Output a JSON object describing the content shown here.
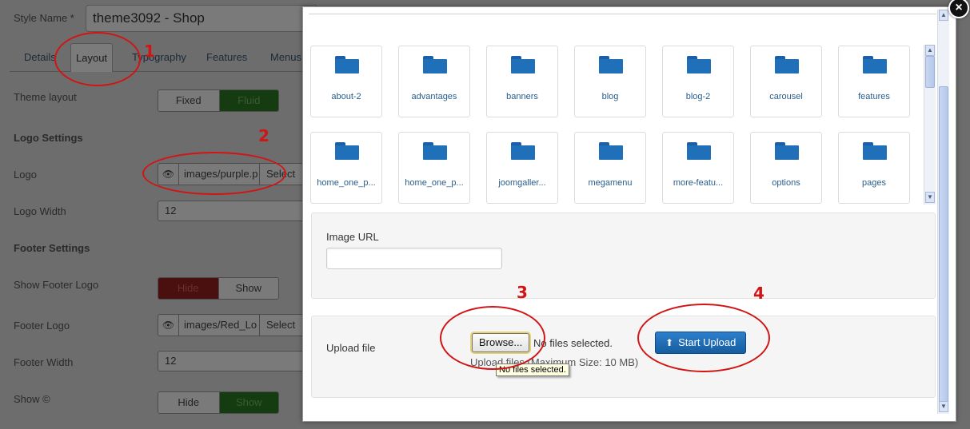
{
  "background": {
    "style_name_label": "Style Name *",
    "style_name_value": "theme3092 - Shop",
    "tabs": [
      "Details",
      "Layout",
      "Typography",
      "Features",
      "Menus"
    ],
    "theme_layout_label": "Theme layout",
    "theme_layout_options": [
      "Fixed",
      "Fluid"
    ],
    "logo_settings_heading": "Logo Settings",
    "logo_label": "Logo",
    "logo_path": "images/purple.p",
    "select_label": "Select",
    "logo_width_label": "Logo Width",
    "logo_width_value": "12",
    "footer_settings_heading": "Footer Settings",
    "show_footer_logo_label": "Show Footer Logo",
    "show_footer_logo_options": [
      "Hide",
      "Show"
    ],
    "footer_logo_label": "Footer Logo",
    "footer_logo_path": "images/Red_Lo",
    "footer_width_label": "Footer Width",
    "footer_width_value": "12",
    "show_copyright_label": "Show ©",
    "show_copyright_options": [
      "Hide",
      "Show"
    ]
  },
  "annotations": [
    "1",
    "2",
    "3",
    "4"
  ],
  "modal": {
    "close_symbol": "×",
    "folders": [
      "about-2",
      "advantages",
      "banners",
      "blog",
      "blog-2",
      "carousel",
      "features",
      "home_one_p...",
      "home_one_p...",
      "joomgaller...",
      "megamenu",
      "more-featu...",
      "options",
      "pages"
    ],
    "image_url_label": "Image URL",
    "image_url_value": "",
    "upload_file_label": "Upload file",
    "browse_label": "Browse...",
    "no_files_text": "No files selected.",
    "upload_hint": "Upload files (Maximum Size: 10 MB)",
    "tooltip_text": "No files selected.",
    "start_upload_label": "Start Upload"
  }
}
